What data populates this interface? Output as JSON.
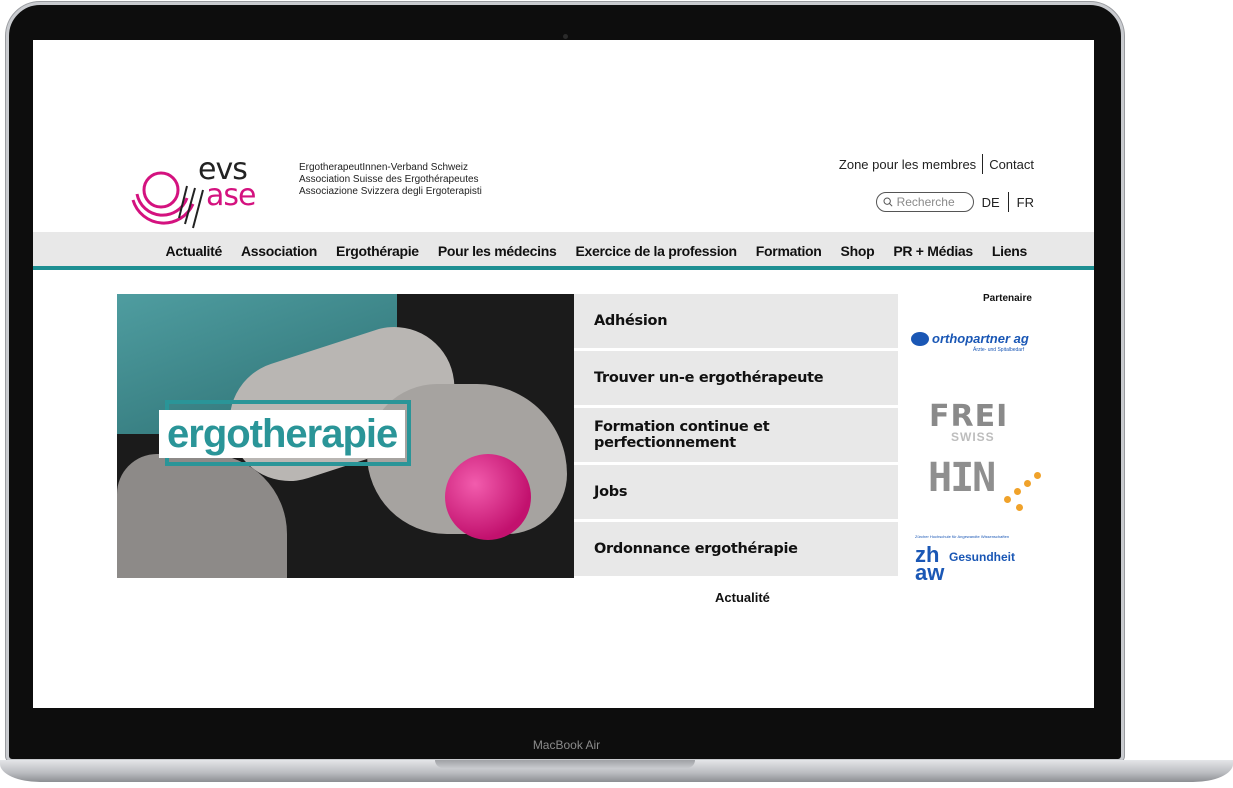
{
  "device": {
    "label": "MacBook Air"
  },
  "logo": {
    "top": "evs",
    "bottom": "ase"
  },
  "association": {
    "line1": "ErgotherapeutInnen-Verband Schweiz",
    "line2": "Association Suisse des Ergothérapeutes",
    "line3": "Associazione Svizzera degli Ergoterapisti"
  },
  "top_links": {
    "members": "Zone pour les membres",
    "contact": "Contact"
  },
  "search": {
    "placeholder": "Recherche"
  },
  "languages": {
    "de": "DE",
    "fr": "FR"
  },
  "nav": {
    "items": [
      "Actualité",
      "Association",
      "Ergothérapie",
      "Pour les médecins",
      "Exercice de la profession",
      "Formation",
      "Shop",
      "PR + Médias",
      "Liens"
    ]
  },
  "hero": {
    "text": "ergotherapie"
  },
  "quick_links": [
    "Adhésion",
    "Trouver un-e ergothérapeute",
    "Formation continue et perfectionnement",
    "Jobs",
    "Ordonnance ergothérapie"
  ],
  "news": {
    "heading": "Actualité"
  },
  "partners": {
    "title": "Partenaire",
    "orthopartner": {
      "name": "orthopartner ag",
      "sub": "Ärzte- und Spitalbedarf"
    },
    "frei": {
      "name": "FREI",
      "sub": "SWISS"
    },
    "hin": {
      "name": "HIN"
    },
    "zhaw": {
      "small": "Zürcher Hochschule für Angewandte Wissenschaften",
      "zh": "zh",
      "aw": "aw",
      "label": "Gesundheit"
    }
  },
  "colors": {
    "brand_magenta": "#d4127f",
    "brand_teal": "#1e8f92",
    "partner_blue": "#1a57b5",
    "hin_orange": "#f0a22a"
  }
}
